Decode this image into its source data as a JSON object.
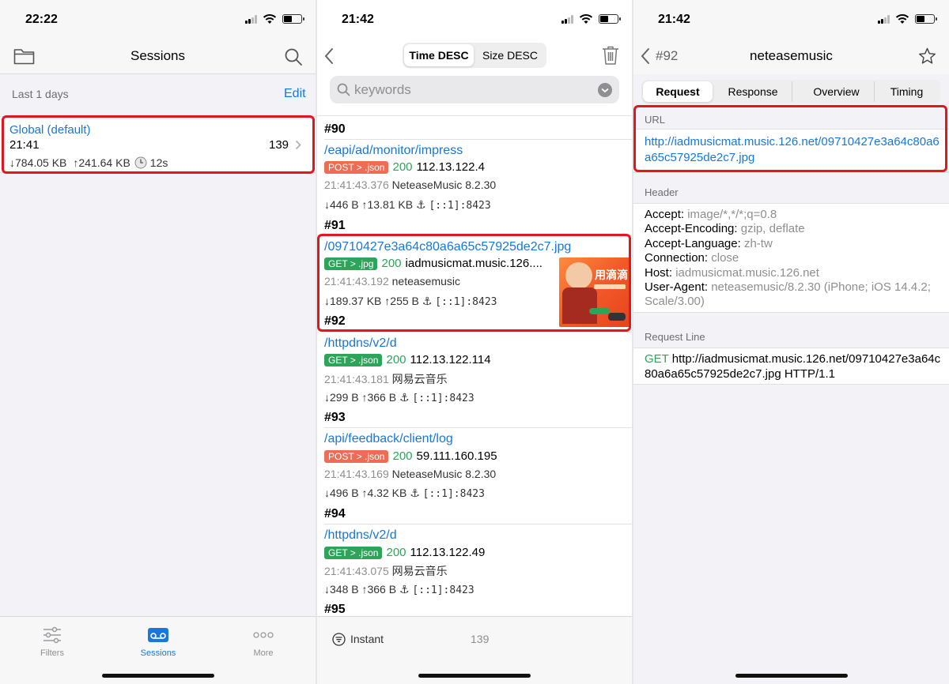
{
  "colors": {
    "accent": "#1877d8",
    "post_badge": "#ee6c53",
    "get_badge": "#2ea35a",
    "highlight": "#e3161d"
  },
  "panel1": {
    "status_time": "22:22",
    "title": "Sessions",
    "icons": {
      "left": "folder-icon",
      "right": "search-icon"
    },
    "section_label": "Last 1 days",
    "edit": "Edit",
    "session": {
      "name": "Global (default)",
      "time": "21:41",
      "count": "139",
      "download": "↓784.05 KB",
      "upload": "↑241.64 KB",
      "duration": "12s"
    },
    "tabs": [
      {
        "label": "Filters",
        "icon": "sliders-icon"
      },
      {
        "label": "Sessions",
        "icon": "sessions-icon"
      },
      {
        "label": "More",
        "icon": "more-icon"
      }
    ]
  },
  "panel2": {
    "status_time": "21:42",
    "sort_options": [
      "Time DESC",
      "Size DESC"
    ],
    "search_placeholder": "keywords",
    "entries": [
      {
        "num": "#90",
        "path": "/eapi/ad/monitor/impress",
        "method": "POST > .json",
        "status": "200",
        "host": "112.13.122.4",
        "time": "21:41:43.376",
        "app": "NeteaseMusic 8.2.30",
        "down": "↓446 B",
        "up": "↑13.81 KB",
        "addr": "[::1]:8423"
      },
      {
        "num": "#91",
        "path": "/09710427e3a64c80a6a65c57925de2c7.jpg",
        "method": "GET > .jpg",
        "status": "200",
        "host": "iadmusicmat.music.126....",
        "time": "21:41:43.192",
        "app": "neteasemusic",
        "down": "↓189.37 KB",
        "up": "↑255 B",
        "addr": "[::1]:8423"
      },
      {
        "num": "#92",
        "path": "/httpdns/v2/d",
        "method": "GET > .json",
        "status": "200",
        "host": "112.13.122.114",
        "time": "21:41:43.181",
        "app": "网易云音乐",
        "down": "↓299 B",
        "up": "↑366 B",
        "addr": "[::1]:8423"
      },
      {
        "num": "#93",
        "path": "/api/feedback/client/log",
        "method": "POST > .json",
        "status": "200",
        "host": "59.111.160.195",
        "time": "21:41:43.169",
        "app": "NeteaseMusic 8.2.30",
        "down": "↓496 B",
        "up": "↑4.32 KB",
        "addr": "[::1]:8423"
      },
      {
        "num": "#94",
        "path": "/httpdns/v2/d",
        "method": "GET > .json",
        "status": "200",
        "host": "112.13.122.49",
        "time": "21:41:43.075",
        "app": "网易云音乐",
        "down": "↓348 B",
        "up": "↑366 B",
        "addr": "[::1]:8423"
      },
      {
        "num": "#95"
      }
    ],
    "thumb_text": "用滴滴",
    "footer": {
      "mode": "Instant",
      "count": "139"
    }
  },
  "panel3": {
    "status_time": "21:42",
    "back_label": "#92",
    "title": "neteasemusic",
    "tabs": [
      "Request",
      "Response",
      "Overview",
      "Timing"
    ],
    "url_label": "URL",
    "url": "http://iadmusicmat.music.126.net/09710427e3a64c80a6a65c57925de2c7.jpg",
    "header_label": "Header",
    "headers": [
      {
        "k": "Accept: ",
        "v": "image/*,*/*;q=0.8"
      },
      {
        "k": "Accept-Encoding: ",
        "v": "gzip, deflate"
      },
      {
        "k": "Accept-Language: ",
        "v": "zh-tw"
      },
      {
        "k": "Connection: ",
        "v": "close"
      },
      {
        "k": "Host: ",
        "v": "iadmusicmat.music.126.net"
      },
      {
        "k": "User-Agent: ",
        "v": "neteasemusic/8.2.30 (iPhone; iOS 14.4.2; Scale/3.00)"
      }
    ],
    "request_line_label": "Request Line",
    "request_method": "GET",
    "request_line": "http://iadmusicmat.music.126.net/09710427e3a64c80a6a65c57925de2c7.jpg HTTP/1.1"
  }
}
